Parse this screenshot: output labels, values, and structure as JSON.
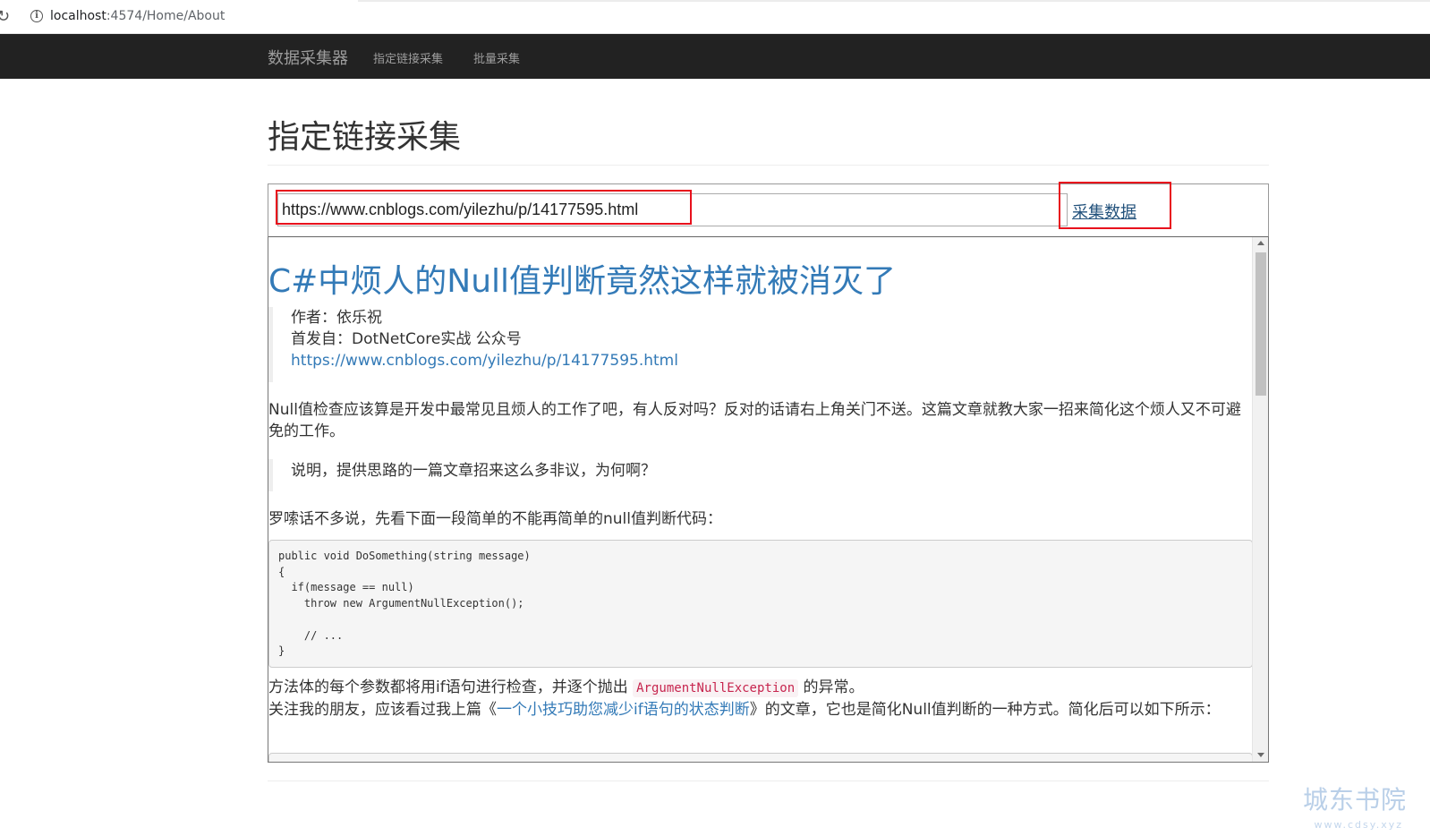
{
  "browser": {
    "url_host": "localhost",
    "url_path": ":4574/Home/About"
  },
  "navbar": {
    "brand": "数据采集器",
    "links": [
      "指定链接采集",
      "批量采集"
    ]
  },
  "page": {
    "title": "指定链接采集"
  },
  "form": {
    "url_value": "https://www.cnblogs.com/yilezhu/p/14177595.html",
    "collect_label": "采集数据"
  },
  "article": {
    "title": "C#中烦人的Null值判断竟然这样就被消灭了",
    "meta": {
      "author": "作者：依乐祝",
      "source": "首发自：DotNetCore实战 公众号",
      "link": "https://www.cnblogs.com/yilezhu/p/14177595.html"
    },
    "intro": "Null值检查应该算是开发中最常见且烦人的工作了吧，有人反对吗？反对的话请右上角关门不送。这篇文章就教大家一招来简化这个烦人又不可避免的工作。",
    "note": "说明，提供思路的一篇文章招来这么多非议，为何啊？",
    "lead": "罗嗦话不多说，先看下面一段简单的不能再简单的null值判断代码：",
    "code": "public void DoSomething(string message)\n{\n  if(message == null)\n    throw new ArgumentNullException();\n\n    // ...\n}",
    "after_code_1": "方法体的每个参数都将用if语句进行检查，并逐个抛出",
    "after_code_code": "ArgumentNullException",
    "after_code_2": "的异常。",
    "follow_1": "关注我的朋友，应该看过我上篇《",
    "follow_link": "一个小技巧助您减少if语句的状态判断",
    "follow_2": "》的文章，它也是简化Null值判断的一种方式。简化后可以如下所示："
  },
  "watermark": {
    "main": "城东书院",
    "sub": "www.cdsy.xyz"
  },
  "colors": {
    "navbar_bg": "#222222",
    "link": "#337ab7",
    "highlight_box": "#e8101c"
  }
}
